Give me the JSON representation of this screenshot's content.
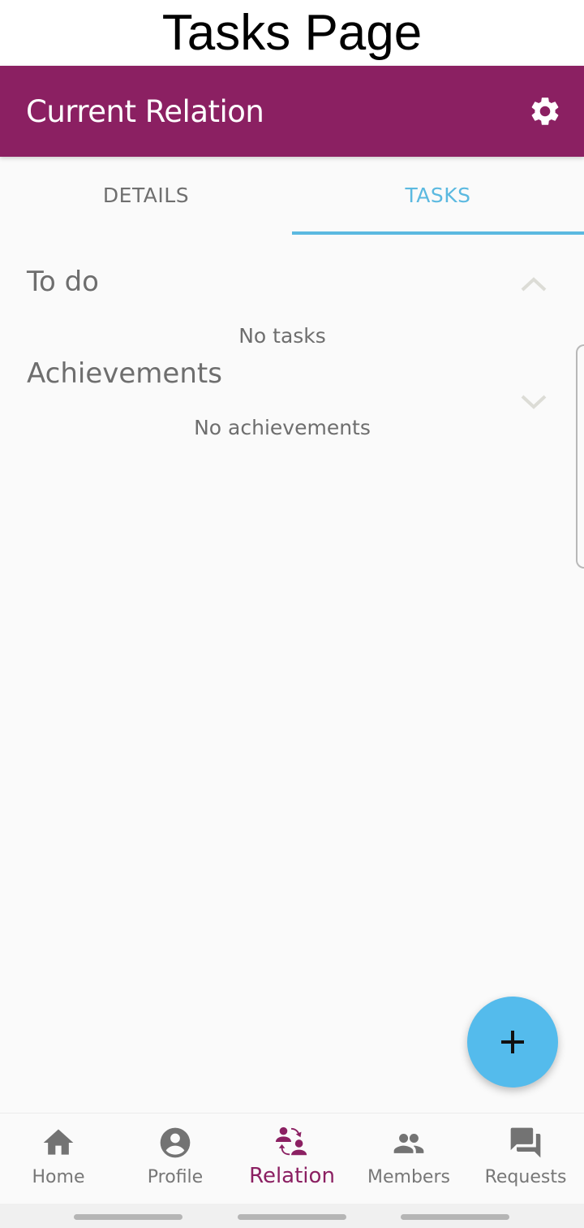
{
  "caption": "Tasks Page",
  "app_bar": {
    "title": "Current Relation",
    "settings_icon": "gear-icon"
  },
  "tabs": [
    {
      "label": "DETAILS",
      "active": false
    },
    {
      "label": "TASKS",
      "active": true
    }
  ],
  "sections": {
    "todo": {
      "title": "To do",
      "empty_text": "No tasks",
      "expanded": true
    },
    "achievements": {
      "title": "Achievements",
      "empty_text": "No achievements",
      "expanded": false
    }
  },
  "fab": {
    "icon": "plus-icon"
  },
  "bottom_nav": {
    "items": [
      {
        "label": "Home",
        "icon": "home-icon",
        "active": false
      },
      {
        "label": "Profile",
        "icon": "account-circle-icon",
        "active": false
      },
      {
        "label": "Relation",
        "icon": "relation-swap-icon",
        "active": true
      },
      {
        "label": "Members",
        "icon": "people-icon",
        "active": false
      },
      {
        "label": "Requests",
        "icon": "forum-icon",
        "active": false
      }
    ]
  },
  "colors": {
    "primary": "#8b2062",
    "accent": "#5bb9e0",
    "fab": "#54bbec",
    "inactive": "#777777"
  }
}
